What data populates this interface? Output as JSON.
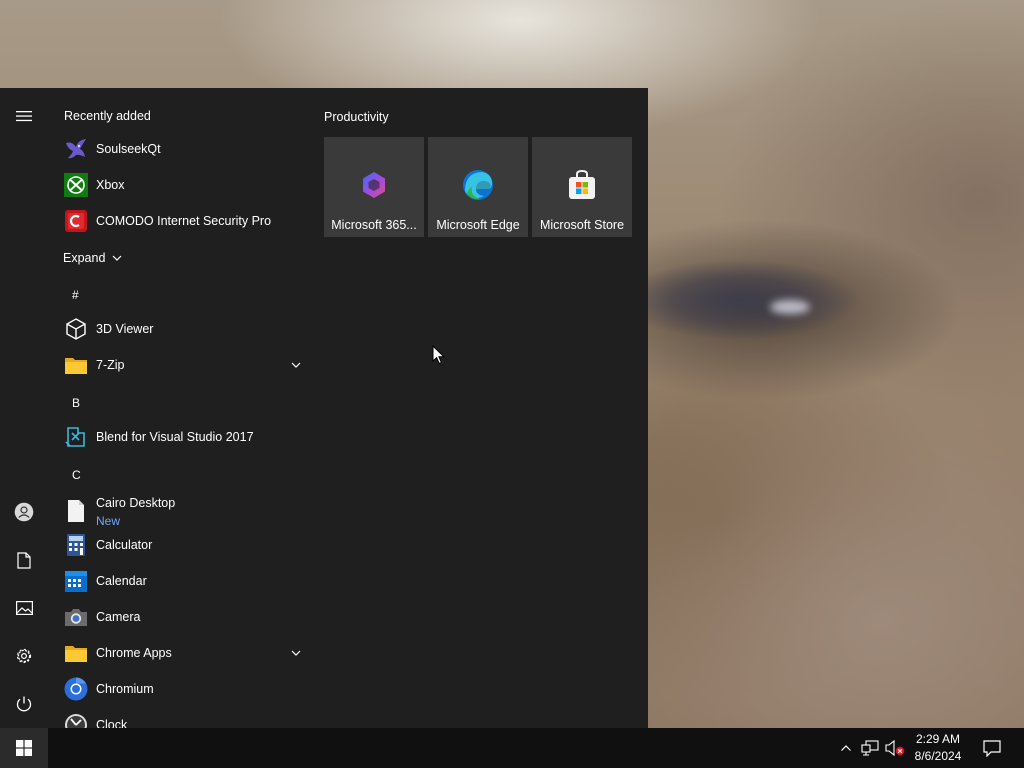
{
  "start_menu": {
    "recently_added_title": "Recently added",
    "recent_apps": [
      {
        "label": "SoulseekQt",
        "icon": "soulseek-bird-icon"
      },
      {
        "label": "Xbox",
        "icon": "xbox-icon"
      },
      {
        "label": "COMODO Internet Security Pro",
        "icon": "comodo-icon"
      }
    ],
    "expand_label": "Expand",
    "letters": {
      "hash": "#",
      "b": "B",
      "c": "C"
    },
    "apps": [
      {
        "label": "3D Viewer",
        "icon": "cube-3d-icon"
      },
      {
        "label": "7-Zip",
        "icon": "folder-icon",
        "has_children": true
      },
      {
        "label": "Blend for Visual Studio 2017",
        "icon": "blend-icon"
      },
      {
        "label": "Cairo Desktop",
        "sublabel": "New",
        "icon": "document-icon"
      },
      {
        "label": "Calculator",
        "icon": "calculator-icon"
      },
      {
        "label": "Calendar",
        "icon": "calendar-icon"
      },
      {
        "label": "Camera",
        "icon": "camera-icon"
      },
      {
        "label": "Chrome Apps",
        "icon": "folder-icon",
        "has_children": true
      },
      {
        "label": "Chromium",
        "icon": "chromium-icon"
      },
      {
        "label": "Clock",
        "icon": "clock-icon"
      }
    ],
    "tile_group_title": "Productivity",
    "tiles": [
      {
        "label": "Microsoft 365...",
        "icon": "microsoft-365-icon"
      },
      {
        "label": "Microsoft Edge",
        "icon": "edge-icon"
      },
      {
        "label": "Microsoft Store",
        "icon": "store-icon"
      }
    ],
    "rail_icons": [
      "hamburger-menu-icon",
      "user-account-icon",
      "documents-icon",
      "pictures-icon",
      "settings-icon",
      "power-icon"
    ]
  },
  "taskbar": {
    "clock": {
      "time": "2:29 AM",
      "date": "8/6/2024"
    },
    "tray_icons": [
      "show-hidden-icons-chevron",
      "network-icon",
      "volume-muted-icon",
      "action-center-icon"
    ]
  },
  "colors": {
    "menu_bg": "#1f1f1f",
    "tile_bg": "#3a3a3a",
    "taskbar_bg": "#101010",
    "new_badge": "#6fa8ff"
  }
}
